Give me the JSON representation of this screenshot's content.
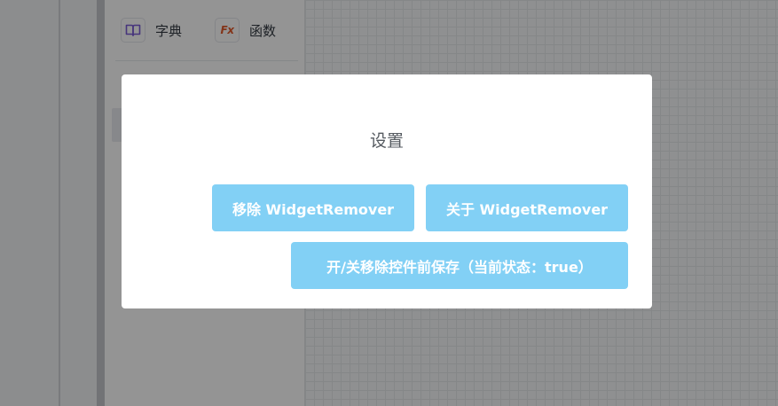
{
  "toolbar": {
    "dictionary": {
      "label": "字典",
      "icon": "book-icon",
      "icon_color": "#7b5cd6"
    },
    "function": {
      "label": "函数",
      "icon": "fx-icon",
      "icon_text": "Fx",
      "icon_color": "#e25a2c"
    }
  },
  "modal": {
    "title": "设置",
    "buttons": {
      "remove": "移除 WidgetRemover",
      "about": "关于 WidgetRemover",
      "toggle_save": "开/关移除控件前保存（当前状态：true）"
    },
    "button_color": "#82d0f5"
  }
}
